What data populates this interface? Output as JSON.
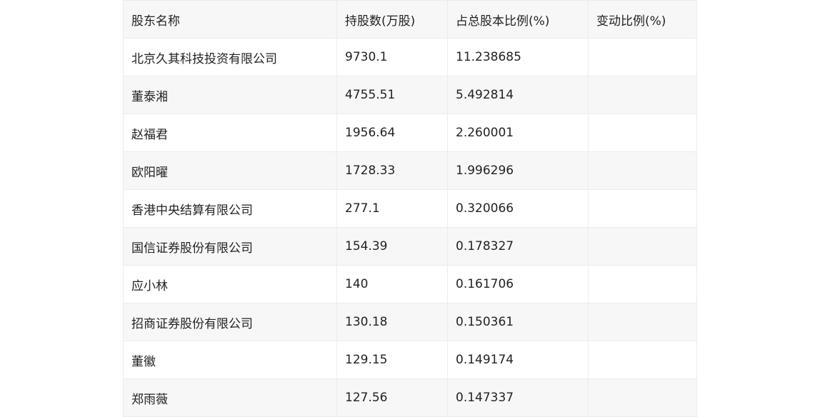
{
  "table": {
    "headers": [
      "股东名称",
      "持股数(万股)",
      "占总股本比例(%)",
      "变动比例(%)"
    ],
    "rows": [
      [
        "北京久其科技投资有限公司",
        "9730.1",
        "11.238685",
        ""
      ],
      [
        "董泰湘",
        "4755.51",
        "5.492814",
        ""
      ],
      [
        "赵福君",
        "1956.64",
        "2.260001",
        ""
      ],
      [
        "欧阳曜",
        "1728.33",
        "1.996296",
        ""
      ],
      [
        "香港中央结算有限公司",
        "277.1",
        "0.320066",
        ""
      ],
      [
        "国信证券股份有限公司",
        "154.39",
        "0.178327",
        ""
      ],
      [
        "应小林",
        "140",
        "0.161706",
        ""
      ],
      [
        "招商证券股份有限公司",
        "130.18",
        "0.150361",
        ""
      ],
      [
        "董徽",
        "129.15",
        "0.149174",
        ""
      ],
      [
        "郑雨薇",
        "127.56",
        "0.147337",
        ""
      ]
    ]
  }
}
